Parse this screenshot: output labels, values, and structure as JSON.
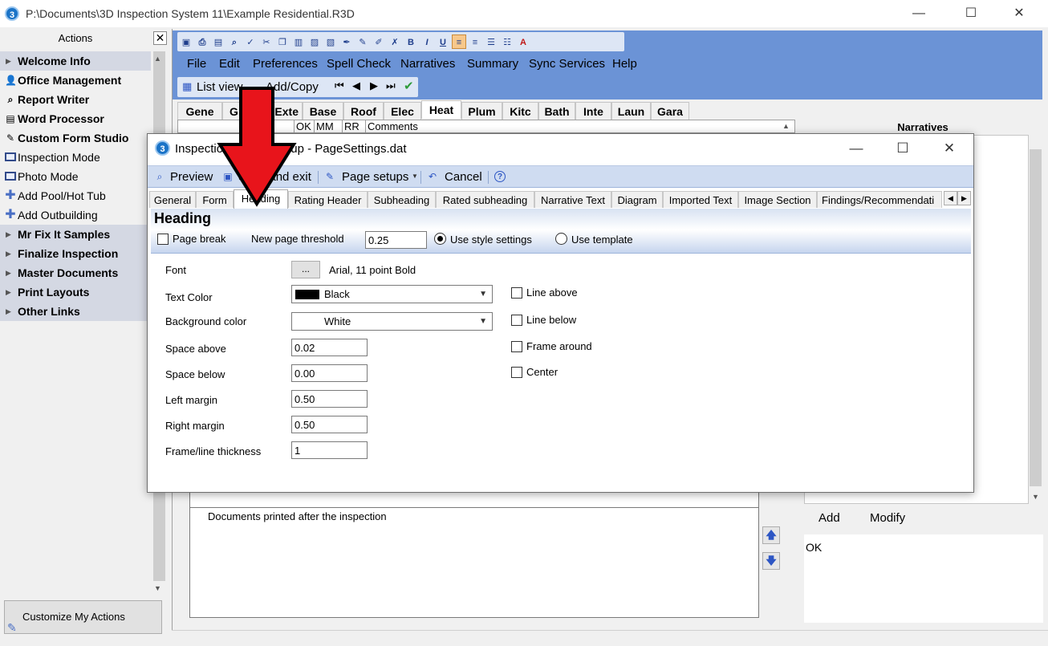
{
  "window": {
    "title": "P:\\Documents\\3D Inspection System 11\\Example Residential.R3D",
    "icon_label": "3",
    "minimize": "—",
    "maximize": "☐",
    "close": "✕"
  },
  "sidebar": {
    "header": "Actions",
    "close_label": "✕",
    "items": [
      {
        "label": "Welcome Info",
        "kind": "group"
      },
      {
        "label": "Office Management",
        "kind": "bold",
        "icon": "person-icon"
      },
      {
        "label": "Report Writer",
        "kind": "bold",
        "icon": "magnifier-icon"
      },
      {
        "label": "Word Processor",
        "kind": "bold",
        "icon": "document-icon"
      },
      {
        "label": "Custom Form Studio",
        "kind": "bold",
        "icon": "pencil-icon"
      },
      {
        "label": "Inspection Mode",
        "kind": "normal",
        "icon": "monitor-icon"
      },
      {
        "label": "Photo Mode",
        "kind": "normal",
        "icon": "monitor-icon"
      },
      {
        "label": "Add Pool/Hot Tub",
        "kind": "normal",
        "icon": "plus-icon"
      },
      {
        "label": "Add Outbuilding",
        "kind": "normal",
        "icon": "plus-icon"
      },
      {
        "label": "Mr Fix It Samples",
        "kind": "group"
      },
      {
        "label": "Finalize Inspection",
        "kind": "group"
      },
      {
        "label": "Master Documents",
        "kind": "group"
      },
      {
        "label": "Print Layouts",
        "kind": "group"
      },
      {
        "label": "Other Links",
        "kind": "group"
      }
    ],
    "customize_label": "Customize My Actions"
  },
  "menubar": [
    "File",
    "Edit",
    "Preferences",
    "Spell Check",
    "Narratives",
    "Summary",
    "Sync Services",
    "Help"
  ],
  "nav_toolbar": {
    "list_view": "List view",
    "add_copy": "Add/Copy"
  },
  "section_tabs": [
    "Gene",
    "G",
    "Exte",
    "Base",
    "Roof",
    "Elec",
    "Heat",
    "Plum",
    "Kitc",
    "Bath",
    "Inte",
    "Laun",
    "Gara"
  ],
  "active_section_tab": "Heat",
  "grid_headers": [
    "OK",
    "MM",
    "RR",
    "Comments"
  ],
  "narratives": {
    "title": "Narratives",
    "add": "Add",
    "modify": "Modify",
    "text": "OK"
  },
  "documents_text": "Documents printed after the inspection",
  "dialog": {
    "title": "Inspection Report Setup - PageSettings.dat",
    "toolbar": {
      "preview": "Preview",
      "save_exit": "Save and exit",
      "page_setups": "Page setups",
      "cancel": "Cancel"
    },
    "tabs": [
      "General",
      "Form",
      "Heading",
      "Rating Header",
      "Subheading",
      "Rated subheading",
      "Narrative Text",
      "Diagram",
      "Imported Text",
      "Image Section",
      "Findings/Recommendati"
    ],
    "active_tab": "Heading",
    "heading": {
      "title": "Heading",
      "page_break_label": "Page break",
      "threshold_label": "New page threshold",
      "threshold_value": "0.25",
      "use_style_label": "Use style settings",
      "use_template_label": "Use template",
      "use_style_selected": true
    },
    "form": {
      "font_label": "Font",
      "font_button": "...",
      "font_value": "Arial, 11 point Bold",
      "text_color_label": "Text Color",
      "text_color_value": "Black",
      "text_color_hex": "#000000",
      "bg_color_label": "Background color",
      "bg_color_value": "White",
      "space_above_label": "Space above",
      "space_above_value": "0.02",
      "space_below_label": "Space below",
      "space_below_value": "0.00",
      "left_margin_label": "Left margin",
      "left_margin_value": "0.50",
      "right_margin_label": "Right margin",
      "right_margin_value": "0.50",
      "frame_label": "Frame/line thickness",
      "frame_value": "1",
      "line_above_label": "Line above",
      "line_below_label": "Line below",
      "frame_around_label": "Frame around",
      "center_label": "Center"
    }
  },
  "overlay": {
    "arrow_color": "#e8141b"
  }
}
